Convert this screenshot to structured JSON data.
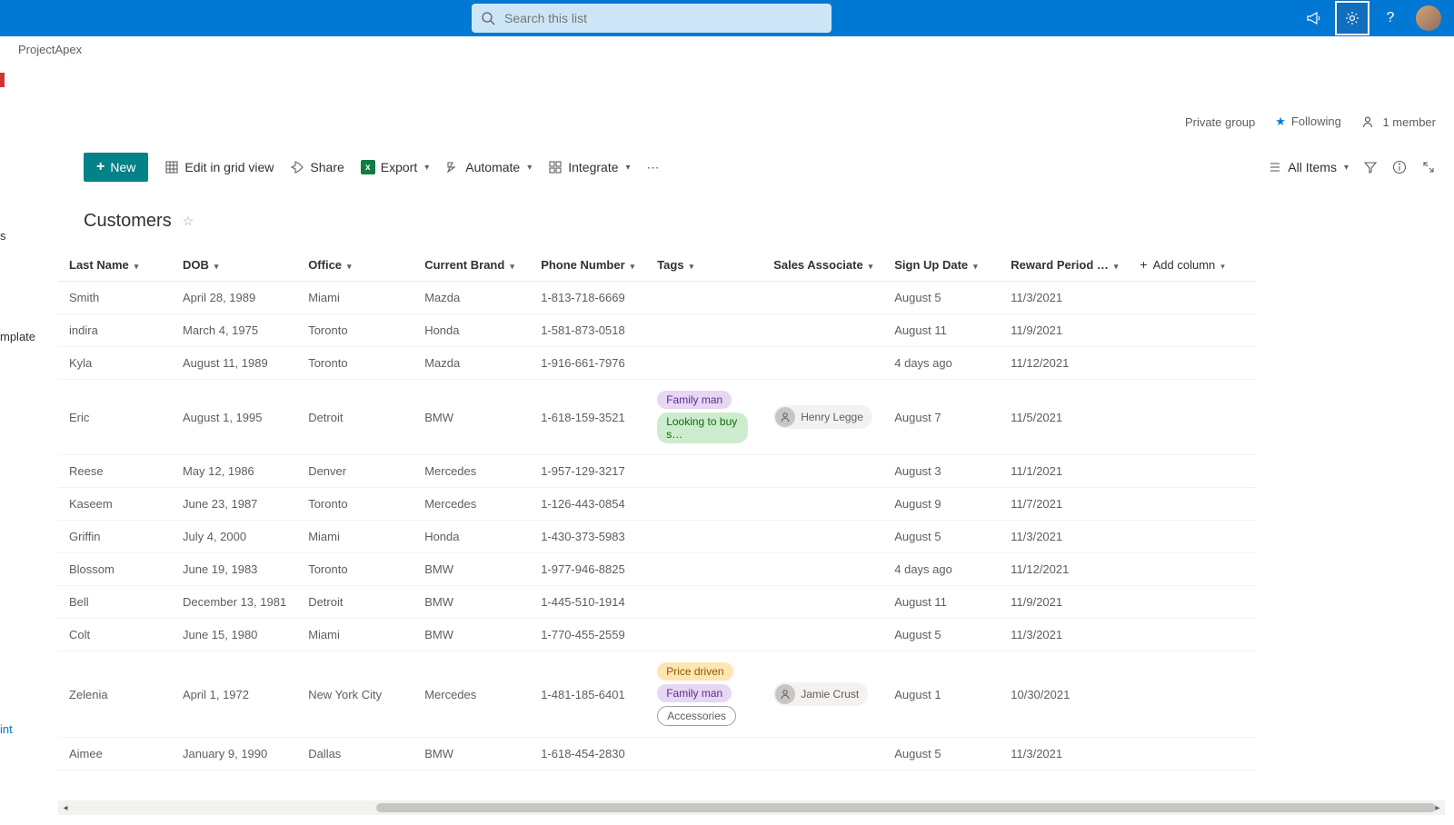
{
  "suite": {
    "search_placeholder": "Search this list",
    "site_name": "ProjectApex"
  },
  "info": {
    "privacy": "Private group",
    "follow": "Following",
    "members": "1 member"
  },
  "cmd": {
    "new": "New",
    "edit_grid": "Edit in grid view",
    "share": "Share",
    "export": "Export",
    "automate": "Automate",
    "integrate": "Integrate",
    "view": "All Items"
  },
  "list": {
    "title": "Customers"
  },
  "leftnav": {
    "a": "s",
    "b": "mplate",
    "c": "int"
  },
  "columns": {
    "last_name": "Last Name",
    "dob": "DOB",
    "office": "Office",
    "brand": "Current Brand",
    "phone": "Phone Number",
    "tags": "Tags",
    "assoc": "Sales Associate",
    "signup": "Sign Up Date",
    "reward": "Reward Period …",
    "add": "Add column"
  },
  "tag_labels": {
    "family": "Family man",
    "buy": "Looking to buy s…",
    "price": "Price driven",
    "access": "Accessories"
  },
  "rows": [
    {
      "last": "Smith",
      "dob": "April 28, 1989",
      "office": "Miami",
      "brand": "Mazda",
      "phone": "1-813-718-6669",
      "tags": [],
      "assoc": "",
      "signup": "August 5",
      "reward": "11/3/2021"
    },
    {
      "last": "indira",
      "dob": "March 4, 1975",
      "office": "Toronto",
      "brand": "Honda",
      "phone": "1-581-873-0518",
      "tags": [],
      "assoc": "",
      "signup": "August 11",
      "reward": "11/9/2021"
    },
    {
      "last": "Kyla",
      "dob": "August 11, 1989",
      "office": "Toronto",
      "brand": "Mazda",
      "phone": "1-916-661-7976",
      "tags": [],
      "assoc": "",
      "signup": "4 days ago",
      "reward": "11/12/2021"
    },
    {
      "last": "Eric",
      "dob": "August 1, 1995",
      "office": "Detroit",
      "brand": "BMW",
      "phone": "1-618-159-3521",
      "tags": [
        "family",
        "buy"
      ],
      "assoc": "Henry Legge",
      "signup": "August 7",
      "reward": "11/5/2021"
    },
    {
      "last": "Reese",
      "dob": "May 12, 1986",
      "office": "Denver",
      "brand": "Mercedes",
      "phone": "1-957-129-3217",
      "tags": [],
      "assoc": "",
      "signup": "August 3",
      "reward": "11/1/2021"
    },
    {
      "last": "Kaseem",
      "dob": "June 23, 1987",
      "office": "Toronto",
      "brand": "Mercedes",
      "phone": "1-126-443-0854",
      "tags": [],
      "assoc": "",
      "signup": "August 9",
      "reward": "11/7/2021"
    },
    {
      "last": "Griffin",
      "dob": "July 4, 2000",
      "office": "Miami",
      "brand": "Honda",
      "phone": "1-430-373-5983",
      "tags": [],
      "assoc": "",
      "signup": "August 5",
      "reward": "11/3/2021"
    },
    {
      "last": "Blossom",
      "dob": "June 19, 1983",
      "office": "Toronto",
      "brand": "BMW",
      "phone": "1-977-946-8825",
      "tags": [],
      "assoc": "",
      "signup": "4 days ago",
      "reward": "11/12/2021"
    },
    {
      "last": "Bell",
      "dob": "December 13, 1981",
      "office": "Detroit",
      "brand": "BMW",
      "phone": "1-445-510-1914",
      "tags": [],
      "assoc": "",
      "signup": "August 11",
      "reward": "11/9/2021"
    },
    {
      "last": "Colt",
      "dob": "June 15, 1980",
      "office": "Miami",
      "brand": "BMW",
      "phone": "1-770-455-2559",
      "tags": [],
      "assoc": "",
      "signup": "August 5",
      "reward": "11/3/2021"
    },
    {
      "last": "Zelenia",
      "dob": "April 1, 1972",
      "office": "New York City",
      "brand": "Mercedes",
      "phone": "1-481-185-6401",
      "tags": [
        "price",
        "family",
        "access"
      ],
      "assoc": "Jamie Crust",
      "signup": "August 1",
      "reward": "10/30/2021"
    },
    {
      "last": "Aimee",
      "dob": "January 9, 1990",
      "office": "Dallas",
      "brand": "BMW",
      "phone": "1-618-454-2830",
      "tags": [],
      "assoc": "",
      "signup": "August 5",
      "reward": "11/3/2021"
    }
  ]
}
